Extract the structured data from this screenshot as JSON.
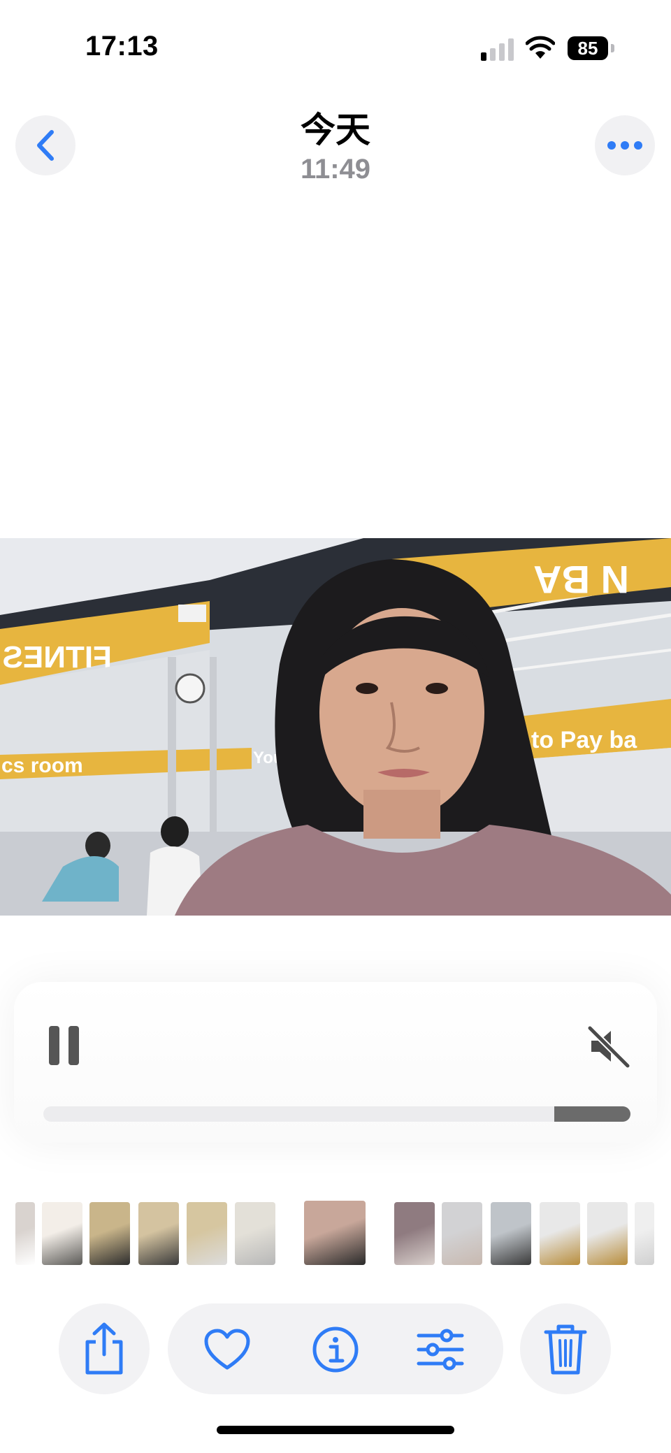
{
  "status_bar": {
    "time": "17:13",
    "battery_level": "85",
    "signal_bars_active": 1,
    "signal_bars_total": 4
  },
  "nav": {
    "title": "今天",
    "subtitle": "11:49",
    "back_icon": "chevron-left-icon",
    "more_icon": "ellipsis-icon"
  },
  "video": {
    "sign_text_left": "FITNES",
    "sign_text_room": "cs room",
    "sign_text_right": "to Pay ba",
    "sign_text_you": "You",
    "sign_text_top": "N  BA"
  },
  "player": {
    "state": "playing",
    "muted": true,
    "progress_fraction": 0.87,
    "pause_icon": "pause-icon",
    "mute_icon": "speaker-muted-icon"
  },
  "filmstrip": {
    "count": 16,
    "current_index": 6
  },
  "toolbar": {
    "share_icon": "share-icon",
    "favorite_icon": "heart-icon",
    "info_icon": "info-icon",
    "edit_icon": "adjust-sliders-icon",
    "delete_icon": "trash-icon"
  },
  "colors": {
    "accent": "#2f7cf6",
    "button_bg": "#f2f2f4",
    "secondary_text": "#8e8e93",
    "gym_yellow": "#e7b53f"
  }
}
